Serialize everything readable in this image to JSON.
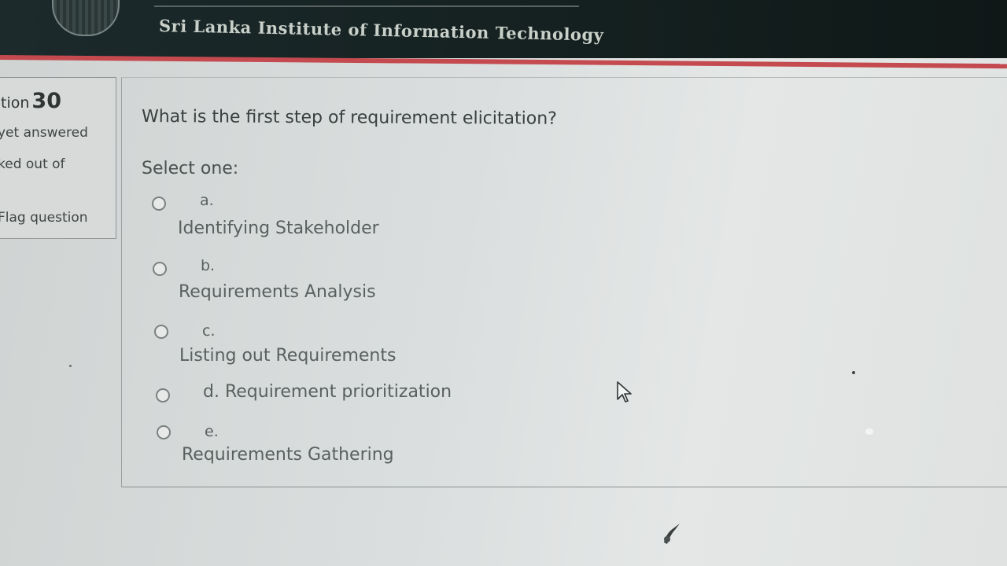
{
  "header": {
    "institution_name": "Sri Lanka Institute of Information Technology"
  },
  "question_info": {
    "question_label": "tion",
    "question_number": "30",
    "state": "yet answered",
    "grade": "ked out of",
    "flag_label": "Flag question"
  },
  "question": {
    "text": "What is the first step of requirement elicitation?",
    "prompt": "Select one:",
    "options": [
      {
        "letter": "a.",
        "text": "Identifying Stakeholder"
      },
      {
        "letter": "b.",
        "text": "Requirements Analysis"
      },
      {
        "letter": "c.",
        "text": "Listing out Requirements"
      },
      {
        "letter": "d.",
        "text": "d. Requirement prioritization"
      },
      {
        "letter": "e.",
        "text": "Requirements Gathering"
      }
    ]
  },
  "colors": {
    "header_bg": "#1c2a2c",
    "accent": "#c44a4f",
    "text": "#3a4040"
  },
  "icons": [
    "logo-icon",
    "mouse-pointer-icon"
  ]
}
